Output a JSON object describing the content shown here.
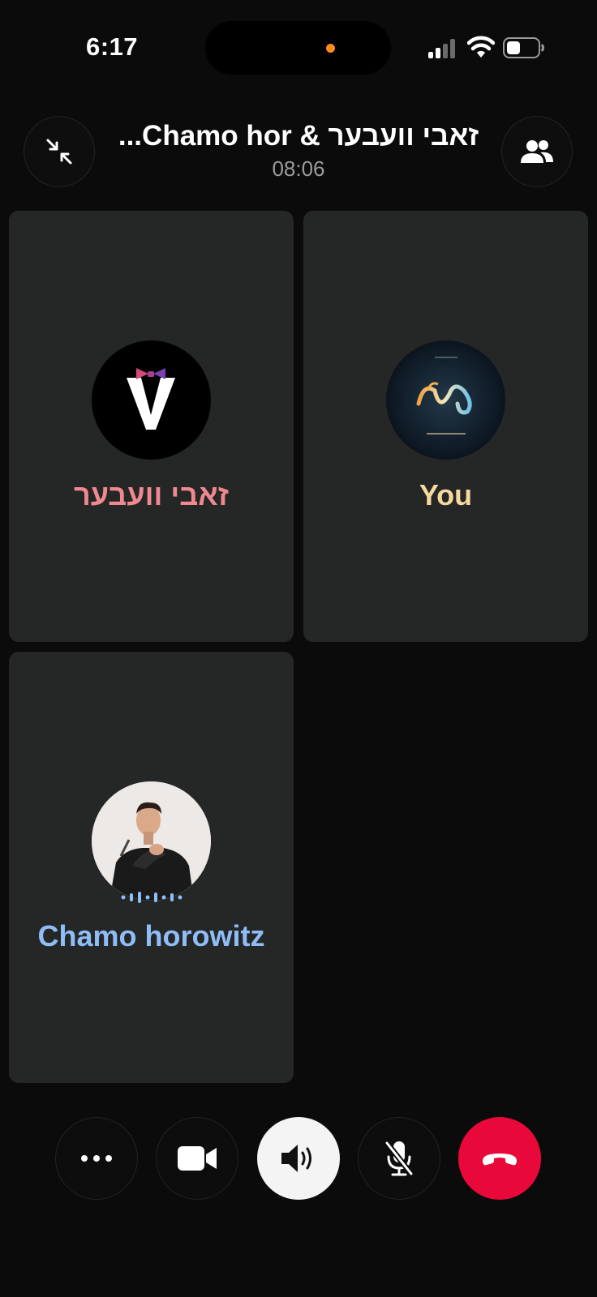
{
  "status_bar": {
    "time": "6:17",
    "icons": [
      "signal-icon",
      "wifi-icon",
      "battery-icon"
    ],
    "island_indicator_color": "#ff8a1e"
  },
  "header": {
    "title": "זאבי וועבער & Chamo hor...",
    "timer": "08:06",
    "left_icon": "minimize-icon",
    "right_icon": "participants-icon"
  },
  "participants": [
    {
      "name": "זאבי וועבער",
      "name_color": "#f0898f",
      "avatar": "tuxedo-v-logo"
    },
    {
      "name": "You",
      "name_color": "#f7d9a0",
      "avatar": "album-art"
    },
    {
      "name": "Chamo horowitz",
      "name_color": "#8fbdf7",
      "avatar": "profile-photo",
      "speaking": true
    }
  ],
  "controls": {
    "more": "more-icon",
    "video": "video-camera-icon",
    "speaker": "speaker-icon",
    "mic": "mic-muted-icon",
    "end_call": "end-call-icon",
    "end_call_color": "#e8093a"
  }
}
